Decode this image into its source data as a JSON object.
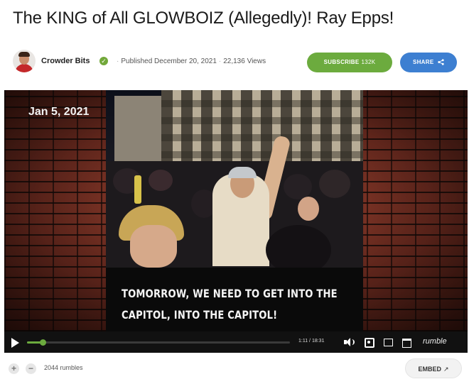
{
  "video": {
    "title": "The KING of All GLOWBOIZ (Allegedly)! Ray Epps!"
  },
  "channel": {
    "name": "Crowder Bits",
    "verified_icon": "verified-check-icon",
    "published": "Published December 20, 2021",
    "views": "22,136 Views"
  },
  "actions": {
    "subscribe_label": "SUBSCRIBE",
    "subscribe_count": "132K",
    "share_label": "SHARE",
    "embed_label": "EMBED"
  },
  "player": {
    "date_overlay": "Jan 5, 2021",
    "caption_line1": "TOMORROW, WE NEED TO GET INTO THE",
    "caption_line2": "CAPITOL, INTO THE CAPITOL!",
    "time": "1:11 / 18:31",
    "progress_fraction": 0.06,
    "brand": "rumble"
  },
  "footer": {
    "upvote": "+",
    "downvote": "−",
    "rumbles": "2044 rumbles"
  },
  "colors": {
    "accent_green": "#6cab3e",
    "share_blue": "#3d7fd1",
    "brick": "#6b2f22"
  }
}
